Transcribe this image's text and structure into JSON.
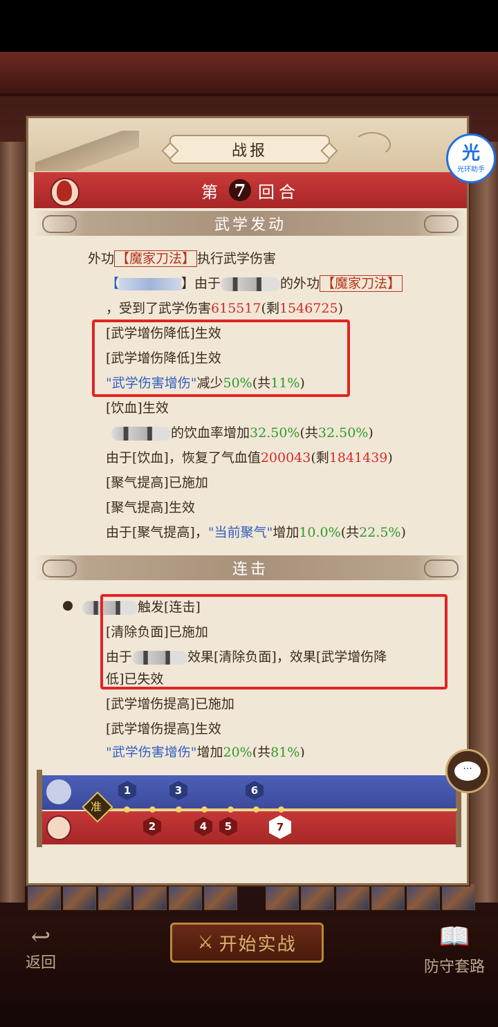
{
  "panel": {
    "title": "战报",
    "round_prefix": "第",
    "round_number": "7",
    "round_suffix": "回合",
    "section1": "武学发动",
    "section2": "连击"
  },
  "badge": {
    "icon": "光",
    "label": "光环助手"
  },
  "log": {
    "l1_a": "外功",
    "l1_skill": "【魔家刀法】",
    "l1_b": "执行武学伤害",
    "l2_a": "【",
    "l2_b": "】由于",
    "l2_c": "的外功",
    "l2_skill": "【魔家刀法】",
    "l3_a": "，受到了武学伤害",
    "l3_dmg": "615517",
    "l3_b": "(剩",
    "l3_rem": "1546725",
    "l3_c": ")",
    "l4": "[武学增伤降低]生效",
    "l5": "[武学增伤降低]生效",
    "l6_a": "\"武学伤害增伤\"",
    "l6_b": "减少",
    "l6_val": "50%",
    "l6_c": "(共",
    "l6_total": "11%",
    "l6_d": ")",
    "l7": "[饮血]生效",
    "l8_a": "的饮血率增加",
    "l8_val": "32.50%",
    "l8_b": "(共",
    "l8_total": "32.50%",
    "l8_c": ")",
    "l9_a": "由于[饮血]，恢复了气血值",
    "l9_val": "200043",
    "l9_b": "(剩",
    "l9_rem": "1841439",
    "l9_c": ")",
    "l10": "[聚气提高]已施加",
    "l11": "[聚气提高]生效",
    "l12_a": "由于[聚气提高]，",
    "l12_b": "\"当前聚气\"",
    "l12_c": "增加",
    "l12_val": "10.0%",
    "l12_d": "(共",
    "l12_total": "22.5%",
    "l12_e": ")",
    "c1": "触发[连击]",
    "c2": "[清除负面]已施加",
    "c3_a": "由于",
    "c3_b": "效果[清除负面]，效果[武学增伤降",
    "c4": "低]已失效",
    "c5": "[武学增伤提高]已施加",
    "c6": "[武学增伤提高]生效",
    "c7_a": "\"武学伤害增伤\"",
    "c7_b": "增加",
    "c7_val": "20%",
    "c7_c": "(共",
    "c7_total": "81%",
    "c7_d": ")"
  },
  "timeline": {
    "zhun": "准",
    "top_rounds": [
      "1",
      "3",
      "6"
    ],
    "bottom_rounds": [
      "2",
      "4",
      "5",
      "7"
    ]
  },
  "chat_icon": "···",
  "bottom": {
    "back": "返回",
    "start": "开始实战",
    "defend": "防守套路"
  }
}
